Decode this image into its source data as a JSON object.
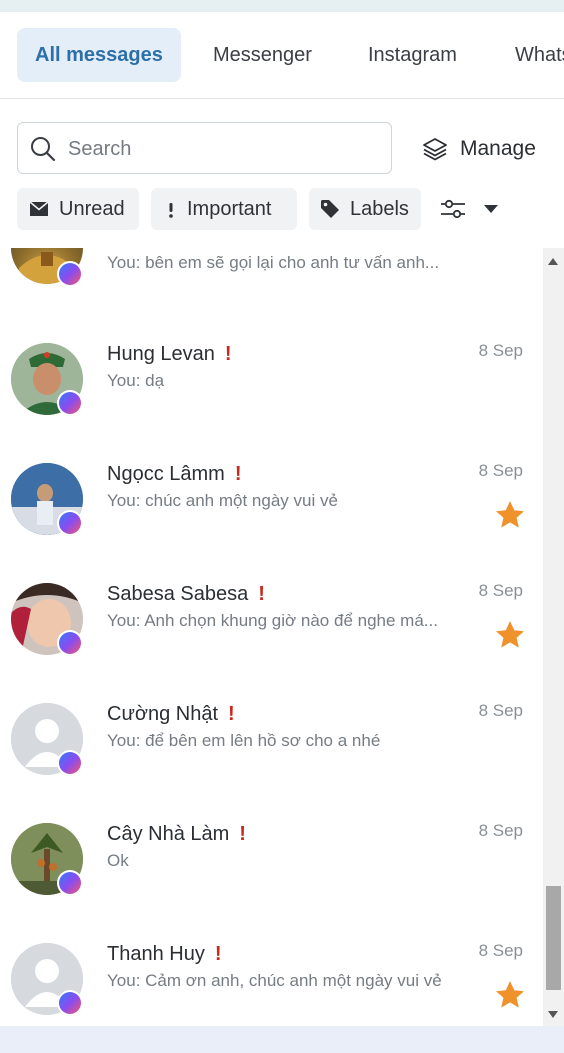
{
  "tabs": [
    {
      "label": "All messages",
      "active": true
    },
    {
      "label": "Messenger",
      "active": false
    },
    {
      "label": "Instagram",
      "active": false
    },
    {
      "label": "WhatsApp",
      "active": false
    }
  ],
  "search": {
    "placeholder": "Search"
  },
  "manage": {
    "label": "Manage"
  },
  "filters": {
    "unread": "Unread",
    "important": "Important",
    "labels": "Labels"
  },
  "conversations": [
    {
      "name": "",
      "preview": "You: bên em sẽ gọi lại cho anh tư vấn anh...",
      "date": "",
      "important": false,
      "starred": false
    },
    {
      "name": "Hung Levan",
      "preview": "You: dạ",
      "date": "8 Sep",
      "important": true,
      "starred": false
    },
    {
      "name": "Ngọcc Lâmm",
      "preview": "You: chúc anh một ngày vui vẻ",
      "date": "8 Sep",
      "important": true,
      "starred": true
    },
    {
      "name": "Sabesa Sabesa",
      "preview": "You: Anh chọn khung giờ nào để nghe má...",
      "date": "8 Sep",
      "important": true,
      "starred": true
    },
    {
      "name": "Cường Nhật",
      "preview": "You: để bên em lên hồ sơ cho a nhé",
      "date": "8 Sep",
      "important": true,
      "starred": false
    },
    {
      "name": "Cây Nhà Làm",
      "preview": "Ok",
      "date": "8 Sep",
      "important": true,
      "starred": false
    },
    {
      "name": "Thanh Huy",
      "preview": "You: Cảm ơn anh, chúc anh một ngày vui vẻ",
      "date": "8 Sep",
      "important": true,
      "starred": true
    }
  ],
  "icons": {
    "search": "search-icon",
    "manage": "layers-icon",
    "unread": "envelope-icon",
    "important": "exclamation-icon",
    "labels": "tag-icon",
    "filter": "sliders-icon",
    "dropdown": "caret-down-icon",
    "badge": "messenger-icon",
    "star": "star-icon"
  },
  "colors": {
    "accent": "#2d6fa8",
    "active_tab_bg": "#e3eef8",
    "important": "#c8281e",
    "star": "#f0922b"
  }
}
